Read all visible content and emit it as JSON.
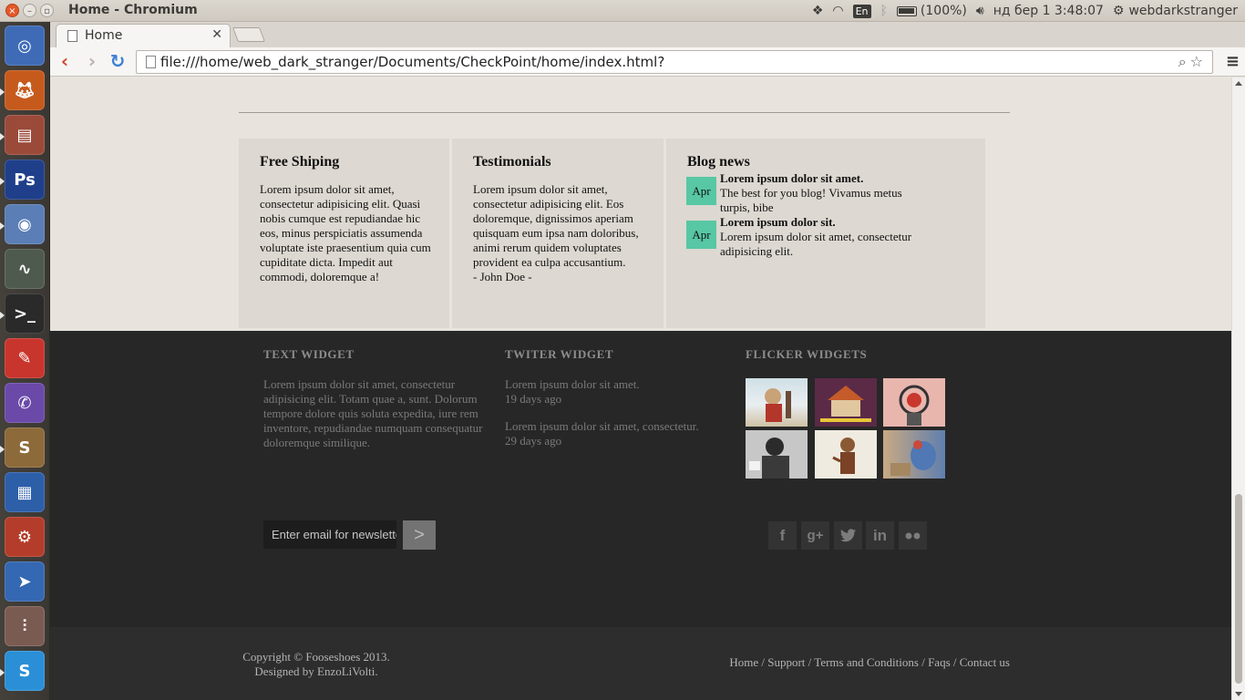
{
  "window": {
    "title": "Home - Chromium"
  },
  "tray": {
    "dropbox_icon": "dropbox-icon",
    "wifi_icon": "wifi-icon",
    "keyboard_layout": "En",
    "bluetooth_icon": "bluetooth-icon",
    "battery": "(100%)",
    "datetime": "нд бер  1  3:48:07",
    "username": "webdarkstranger"
  },
  "launcher": {
    "items": [
      "ubuntu-dash",
      "firefox",
      "files",
      "photoshop",
      "chromium",
      "system-monitor",
      "terminal",
      "text-editor",
      "viber",
      "sublime-text",
      "libreoffice-writer",
      "system-settings",
      "app",
      "mixer",
      "skype"
    ]
  },
  "browser": {
    "tab_label": "Home",
    "url": "file:///home/web_dark_stranger/Documents/CheckPoint/home/index.html?"
  },
  "boxes": {
    "shipping": {
      "title": "Free Shiping",
      "text": "Lorem ipsum dolor sit amet, consectetur adipisicing elit. Quasi nobis cumque est repudiandae hic eos, minus perspiciatis assumenda voluptate iste praesentium quia cum cupiditate dicta. Impedit aut commodi, doloremque a!"
    },
    "testimonials": {
      "title": "Testimonials",
      "text": "Lorem ipsum dolor sit amet, consectetur adipisicing elit. Eos doloremque, dignissimos aperiam quisquam eum ipsa nam doloribus, animi rerum quidem voluptates provident ea culpa accusantium.",
      "author": "- John Doe -"
    },
    "blog": {
      "title": "Blog news",
      "items": [
        {
          "date": "Apr",
          "title": "Lorem ipsum dolor sit amet.",
          "text": "The best for you blog! Vivamus metus turpis, bibe"
        },
        {
          "date": "Apr",
          "title": "Lorem ipsum dolor sit.",
          "text": "Lorem ipsum dolor sit amet, consectetur adipisicing elit."
        }
      ]
    }
  },
  "footer": {
    "text_widget": {
      "title": "TEXT WIDGET",
      "text": "Lorem ipsum dolor sit amet, consectetur adipisicing elit. Totam quae a, sunt. Dolorum tempore dolore quis soluta expedita, iure rem inventore, repudiandae numquam consequatur doloremque similique."
    },
    "twitter_widget": {
      "title": "TWITER WIDGET",
      "tweets": [
        {
          "text": "Lorem ipsum dolor sit amet.",
          "ago": "19 days ago"
        },
        {
          "text": "Lorem ipsum dolor sit amet, consectetur.",
          "ago": "29 days ago"
        }
      ]
    },
    "flickr_widget": {
      "title": "FLICKER WIDGETS"
    },
    "newsletter": {
      "placeholder": "Enter email for newsletter",
      "button": ">"
    },
    "social": [
      "f",
      "g+",
      "twitter-icon",
      "in",
      "flickr-icon"
    ],
    "copyright": "Copyright © Fooseshoes 2013.",
    "designed_by": "Designed by EnzoLiVolti.",
    "links": [
      "Home",
      "Support",
      "Terms and Conditions",
      "Faqs",
      "Contact us"
    ]
  }
}
